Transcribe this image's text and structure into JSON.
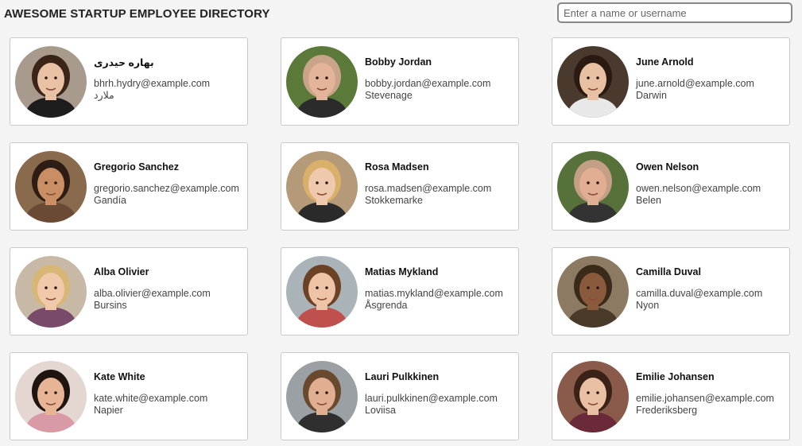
{
  "header": {
    "title": "AWESOME STARTUP EMPLOYEE DIRECTORY",
    "search_placeholder": "Enter a name or username",
    "search_value": ""
  },
  "employees": [
    {
      "name": "بهاره حیدری",
      "email": "bhrh.hydry@example.com",
      "city": "ملارد",
      "avatar": {
        "bg": "#a89a8c",
        "skin": "#e9c2a6",
        "hair": "#3b2418",
        "shirt": "#1d1d1d"
      }
    },
    {
      "name": "Bobby Jordan",
      "email": "bobby.jordan@example.com",
      "city": "Stevenage",
      "avatar": {
        "bg": "#5b7a3a",
        "skin": "#e3b39a",
        "hair": "#c9a38a",
        "shirt": "#2b2b2b"
      }
    },
    {
      "name": "June Arnold",
      "email": "june.arnold@example.com",
      "city": "Darwin",
      "avatar": {
        "bg": "#4a3a2e",
        "skin": "#e8c1a2",
        "hair": "#2a1a12",
        "shirt": "#e8e8e8"
      }
    },
    {
      "name": "Gregorio Sanchez",
      "email": "gregorio.sanchez@example.com",
      "city": "Gandía",
      "avatar": {
        "bg": "#8a6a4c",
        "skin": "#c98e63",
        "hair": "#2d1d14",
        "shirt": "#6a4a34"
      }
    },
    {
      "name": "Rosa Madsen",
      "email": "rosa.madsen@example.com",
      "city": "Stokkemarke",
      "avatar": {
        "bg": "#b49a78",
        "skin": "#efc9ad",
        "hair": "#d9b06a",
        "shirt": "#2a2a2a"
      }
    },
    {
      "name": "Owen Nelson",
      "email": "owen.nelson@example.com",
      "city": "Belen",
      "avatar": {
        "bg": "#56723a",
        "skin": "#e1ae94",
        "hair": "#c49f86",
        "shirt": "#333333"
      }
    },
    {
      "name": "Alba Olivier",
      "email": "alba.olivier@example.com",
      "city": "Bursins",
      "avatar": {
        "bg": "#c7b9a6",
        "skin": "#f0c9aa",
        "hair": "#d8b676",
        "shirt": "#7a4a6a"
      }
    },
    {
      "name": "Matias Mykland",
      "email": "matias.mykland@example.com",
      "city": "Åsgrenda",
      "avatar": {
        "bg": "#a9b3b8",
        "skin": "#efc4a6",
        "hair": "#6b4226",
        "shirt": "#c0504d"
      }
    },
    {
      "name": "Camilla Duval",
      "email": "camilla.duval@example.com",
      "city": "Nyon",
      "avatar": {
        "bg": "#8c7a62",
        "skin": "#8a5a3c",
        "hair": "#3a2a1a",
        "shirt": "#4a3a2a"
      }
    },
    {
      "name": "Kate White",
      "email": "kate.white@example.com",
      "city": "Napier",
      "avatar": {
        "bg": "#e4d6d0",
        "skin": "#e7b495",
        "hair": "#1e1410",
        "shirt": "#d99aa8"
      }
    },
    {
      "name": "Lauri Pulkkinen",
      "email": "lauri.pulkkinen@example.com",
      "city": "Loviisa",
      "avatar": {
        "bg": "#9aa0a4",
        "skin": "#e0ae90",
        "hair": "#6a4a2e",
        "shirt": "#2f2f2f"
      }
    },
    {
      "name": "Emilie Johansen",
      "email": "emilie.johansen@example.com",
      "city": "Frederiksberg",
      "avatar": {
        "bg": "#8a5a4a",
        "skin": "#eac0a4",
        "hair": "#3a2218",
        "shirt": "#6a2a3a"
      }
    }
  ]
}
